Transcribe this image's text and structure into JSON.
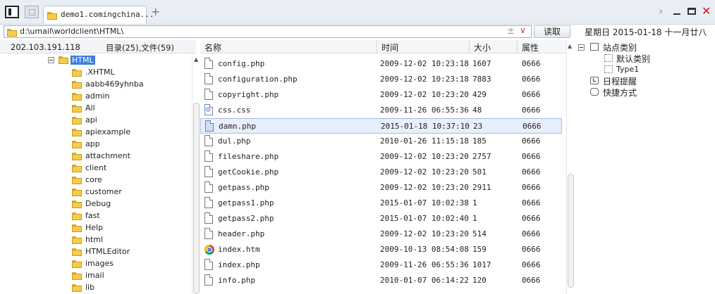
{
  "tab": {
    "title": "demo1.comingchina..."
  },
  "address": {
    "path": "d:\\umail\\worldclient\\HTML\\",
    "star": "±",
    "dropdown": "∨"
  },
  "read_button": "读取",
  "date": "星期日 2015-01-18 十一月廿八",
  "left_panel": {
    "ip": "202.103.191.118",
    "counts": "目录(25),文件(59)",
    "selected": "HTML",
    "folders": [
      ".XHTML",
      "aabb469yhnba",
      "admin",
      "All",
      "api",
      "apiexample",
      "app",
      "attachment",
      "client",
      "core",
      "customer",
      "Debug",
      "fast",
      "Help",
      "html",
      "HTMLEditor",
      "images",
      "imail",
      "lib"
    ]
  },
  "file_list": {
    "headers": {
      "name": "名称",
      "time": "时间",
      "size": "大小",
      "attr": "属性"
    },
    "rows": [
      {
        "name": "config.php",
        "time": "2009-12-02 10:23:18",
        "size": "1607",
        "attr": "0666",
        "icon": "php-file-icon"
      },
      {
        "name": "configuration.php",
        "time": "2009-12-02 10:23:18",
        "size": "7883",
        "attr": "0666",
        "icon": "php-file-icon"
      },
      {
        "name": "copyright.php",
        "time": "2009-12-02 10:23:20",
        "size": "429",
        "attr": "0666",
        "icon": "php-file-icon"
      },
      {
        "name": "css.css",
        "time": "2009-11-26 06:55:36",
        "size": "48",
        "attr": "0666",
        "icon": "css-file-icon"
      },
      {
        "name": "damn.php",
        "time": "2015-01-18 10:37:10",
        "size": "23",
        "attr": "0666",
        "icon": "edited-file-icon",
        "selected": true
      },
      {
        "name": "dul.php",
        "time": "2010-01-26 11:15:18",
        "size": "185",
        "attr": "0666",
        "icon": "php-file-icon"
      },
      {
        "name": "fileshare.php",
        "time": "2009-12-02 10:23:20",
        "size": "2757",
        "attr": "0666",
        "icon": "php-file-icon"
      },
      {
        "name": "getCookie.php",
        "time": "2009-12-02 10:23:20",
        "size": "501",
        "attr": "0666",
        "icon": "php-file-icon"
      },
      {
        "name": "getpass.php",
        "time": "2009-12-02 10:23:20",
        "size": "2911",
        "attr": "0666",
        "icon": "php-file-icon"
      },
      {
        "name": "getpass1.php",
        "time": "2015-01-07 10:02:38",
        "size": "1",
        "attr": "0666",
        "icon": "php-file-icon"
      },
      {
        "name": "getpass2.php",
        "time": "2015-01-07 10:02:40",
        "size": "1",
        "attr": "0666",
        "icon": "php-file-icon"
      },
      {
        "name": "header.php",
        "time": "2009-12-02 10:23:20",
        "size": "514",
        "attr": "0666",
        "icon": "php-file-icon"
      },
      {
        "name": "index.htm",
        "time": "2009-10-13 08:54:08",
        "size": "159",
        "attr": "0666",
        "icon": "chrome-icon"
      },
      {
        "name": "index.php",
        "time": "2009-11-26 06:55:36",
        "size": "1017",
        "attr": "0666",
        "icon": "php-file-icon"
      },
      {
        "name": "info.php",
        "time": "2010-01-07 06:14:22",
        "size": "120",
        "attr": "0666",
        "icon": "php-file-icon"
      }
    ]
  },
  "right_panel": {
    "site_category": "站点类别",
    "default_category": "默认类别",
    "type1": "Type1",
    "schedule": "日程提醒",
    "shortcut": "快捷方式"
  },
  "colors": {
    "selection": "#3b7fdb",
    "close": "#d61414",
    "folder": "#f6cc4c"
  }
}
